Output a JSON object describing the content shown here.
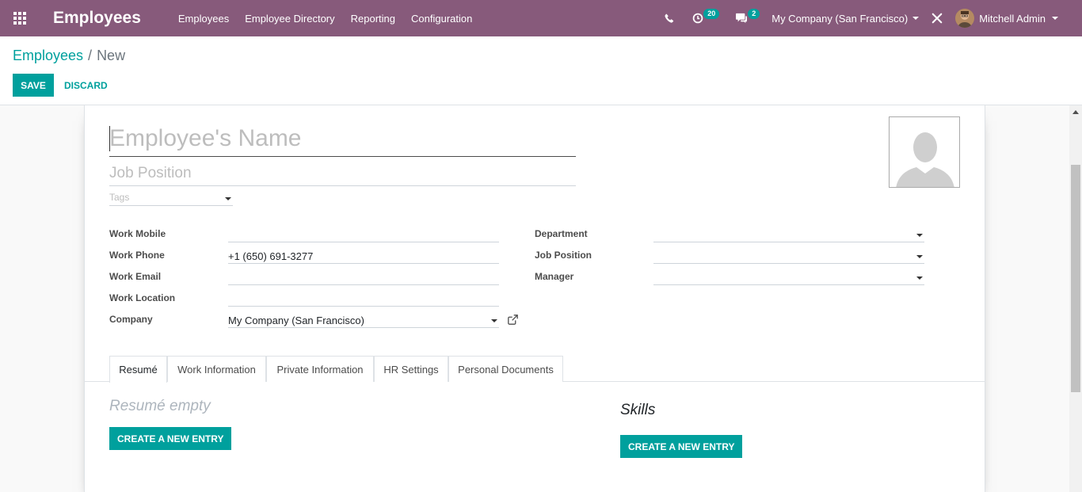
{
  "navbar": {
    "app_title": "Employees",
    "menu": [
      "Employees",
      "Employee Directory",
      "Reporting",
      "Configuration"
    ],
    "activity_count": "20",
    "message_count": "2",
    "company": "My Company (San Francisco)",
    "user": "Mitchell Admin",
    "bar_color": "#875a7b"
  },
  "breadcrumb": {
    "parent": "Employees",
    "separator": "/",
    "current": "New"
  },
  "actions": {
    "save": "SAVE",
    "discard": "DISCARD",
    "accent_color": "#00a09d"
  },
  "form": {
    "name_placeholder": "Employee's Name",
    "job_placeholder": "Job Position",
    "tags_placeholder": "Tags",
    "left_fields": [
      {
        "label": "Work Mobile",
        "value": ""
      },
      {
        "label": "Work Phone",
        "value": "+1 (650) 691-3277"
      },
      {
        "label": "Work Email",
        "value": ""
      },
      {
        "label": "Work Location",
        "value": ""
      },
      {
        "label": "Company",
        "value": "My Company (San Francisco)"
      }
    ],
    "right_fields": [
      {
        "label": "Department",
        "value": ""
      },
      {
        "label": "Job Position",
        "value": ""
      },
      {
        "label": "Manager",
        "value": ""
      }
    ]
  },
  "tabs": [
    "Resumé",
    "Work Information",
    "Private Information",
    "HR Settings",
    "Personal Documents"
  ],
  "resume": {
    "empty_text": "Resumé empty",
    "create_label": "CREATE A NEW ENTRY"
  },
  "skills": {
    "title": "Skills",
    "create_label": "CREATE A NEW ENTRY"
  },
  "icons": [
    "apps-grid-icon",
    "phone-icon",
    "activity-clock-icon",
    "chat-bubble-icon",
    "debug-tools-icon",
    "external-link-icon",
    "avatar-placeholder-icon"
  ]
}
